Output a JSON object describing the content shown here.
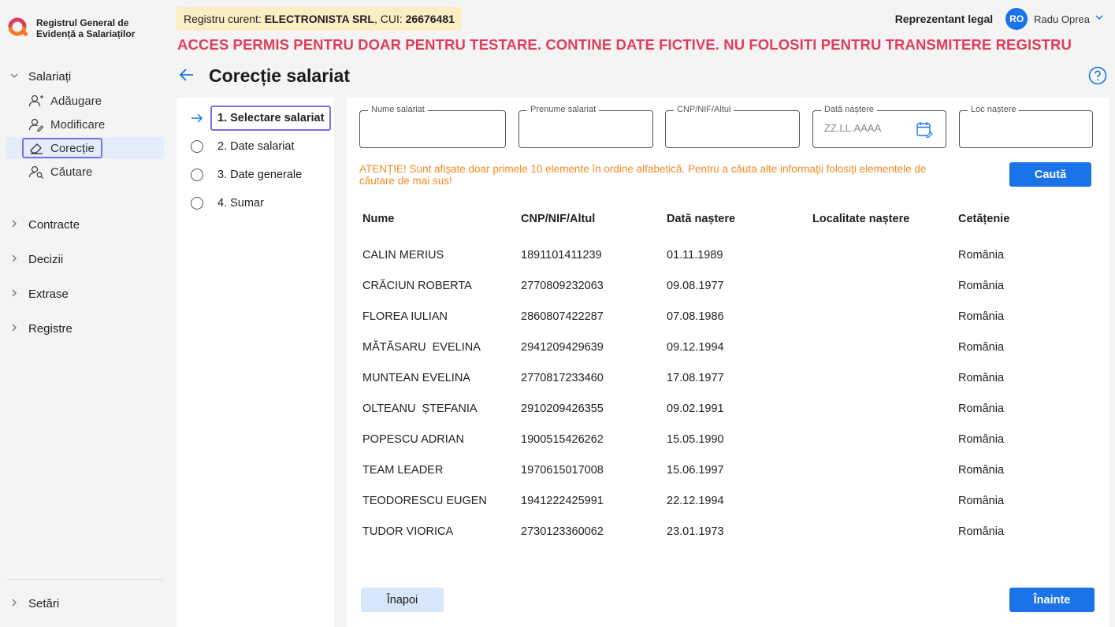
{
  "app": {
    "title_line1": "Registrul General de",
    "title_line2": "Evidență a Salariaților"
  },
  "sidebar": {
    "groups": [
      {
        "label": "Salariați",
        "expanded": true,
        "items": [
          {
            "label": "Adăugare",
            "icon": "user-add-icon"
          },
          {
            "label": "Modificare",
            "icon": "user-edit-icon"
          },
          {
            "label": "Corecție",
            "icon": "eraser-icon",
            "active": true
          },
          {
            "label": "Căutare",
            "icon": "user-search-icon"
          }
        ]
      },
      {
        "label": "Contracte",
        "expanded": false
      },
      {
        "label": "Decizii",
        "expanded": false
      },
      {
        "label": "Extrase",
        "expanded": false
      },
      {
        "label": "Registre",
        "expanded": false
      }
    ],
    "settings_label": "Setări"
  },
  "header": {
    "registry_prefix": "Registru curent: ",
    "company": "ELECTRONISTA SRL",
    "cui_prefix": ", CUI: ",
    "cui": "26676481",
    "warning": "ACCES PERMIS PENTRU DOAR PENTRU TESTARE. CONTINE DATE FICTIVE. NU FOLOSITI PENTRU TRANSMITERE REGISTRU",
    "role": "Reprezentant legal",
    "avatar_initials": "RO",
    "user_name": "Radu Oprea"
  },
  "page": {
    "title": "Corecție salariat"
  },
  "steps": [
    {
      "label": "1. Selectare salariat",
      "current": true
    },
    {
      "label": "2. Date salariat"
    },
    {
      "label": "3. Date generale"
    },
    {
      "label": "4. Sumar"
    }
  ],
  "search": {
    "nume_label": "Nume salariat",
    "nume_value": "",
    "prenume_label": "Prenume salariat",
    "prenume_value": "",
    "cnp_label": "CNP/NIF/Altul",
    "cnp_value": "",
    "data_label": "Dată naștere",
    "data_placeholder": "ZZ.LL.AAAA",
    "loc_label": "Loc naștere",
    "loc_value": "",
    "notice_line1": "ATENȚIE! Sunt afișate doar primele 10 elemente în ordine alfabetică. Pentru a căuta alte informații folosiți elementele de",
    "notice_line2": "căutare de mai sus!",
    "search_button": "Caută"
  },
  "table": {
    "columns": [
      "Nume",
      "CNP/NIF/Altul",
      "Dată naștere",
      "Localitate naștere",
      "Cetățenie"
    ],
    "rows": [
      [
        "CALIN MERIUS",
        "1891101411239",
        "01.11.1989",
        "",
        "România"
      ],
      [
        "CRĂCIUN ROBERTA",
        "2770809232063",
        "09.08.1977",
        "",
        "România"
      ],
      [
        "FLOREA IULIAN",
        "2860807422287",
        "07.08.1986",
        "",
        "România"
      ],
      [
        "MĂTĂSARU  EVELINA",
        "2941209429639",
        "09.12.1994",
        "",
        "România"
      ],
      [
        "MUNTEAN EVELINA",
        "2770817233460",
        "17.08.1977",
        "",
        "România"
      ],
      [
        "OLTEANU  ȘTEFANIA",
        "2910209426355",
        "09.02.1991",
        "",
        "România"
      ],
      [
        "POPESCU ADRIAN",
        "1900515426262",
        "15.05.1990",
        "",
        "România"
      ],
      [
        "TEAM LEADER",
        "1970615017008",
        "15.06.1997",
        "",
        "România"
      ],
      [
        "TEODORESCU EUGEN",
        "1941222425991",
        "22.12.1994",
        "",
        "România"
      ],
      [
        "TUDOR VIORICA",
        "2730123360062",
        "23.01.1973",
        "",
        "România"
      ]
    ]
  },
  "footer": {
    "back_button": "Înapoi",
    "next_button": "Înainte"
  },
  "colors": {
    "accent": "#1a73e8",
    "warning_banner": "#e03d5d",
    "notice": "#f08a24",
    "focus_ring": "#7b6fe0"
  }
}
